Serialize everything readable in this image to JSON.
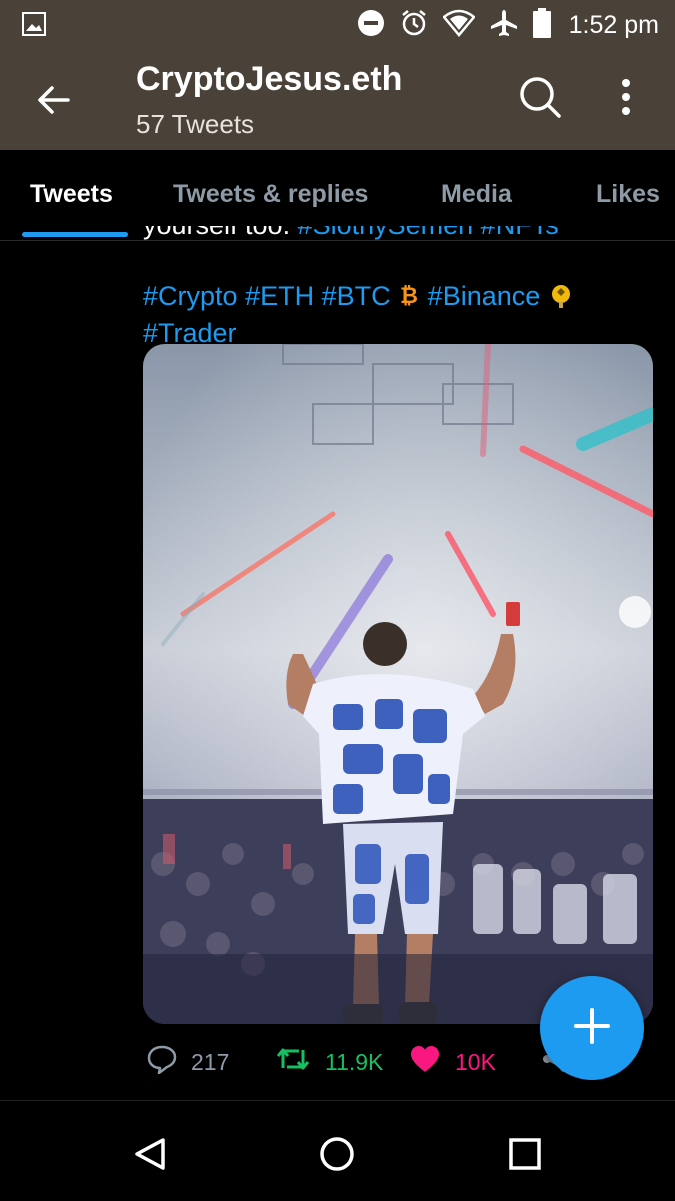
{
  "status": {
    "time": "1:52 pm",
    "icons": [
      "gallery-icon",
      "dnd-icon",
      "alarm-icon",
      "wifi-icon",
      "airplane-icon",
      "battery-icon"
    ]
  },
  "header": {
    "title": "CryptoJesus.eth",
    "subtitle": "57 Tweets"
  },
  "tabs": [
    {
      "label": "Tweets",
      "active": true
    },
    {
      "label": "Tweets & replies",
      "active": false
    },
    {
      "label": "Media",
      "active": false
    },
    {
      "label": "Likes",
      "active": false
    }
  ],
  "tweet": {
    "cut_line": "yourself too. #SlothySemen #NFTs",
    "line1": [
      "#Crypto",
      "#ETH",
      "#BTC",
      "#Binance"
    ],
    "line2": "#Trader",
    "stats": {
      "replies": "217",
      "retweets": "11.9K",
      "likes": "10K"
    }
  },
  "colors": {
    "accent": "#1d9bf0",
    "retweet": "#17bf63",
    "like": "#f91880",
    "header_bg": "#4a4238"
  }
}
